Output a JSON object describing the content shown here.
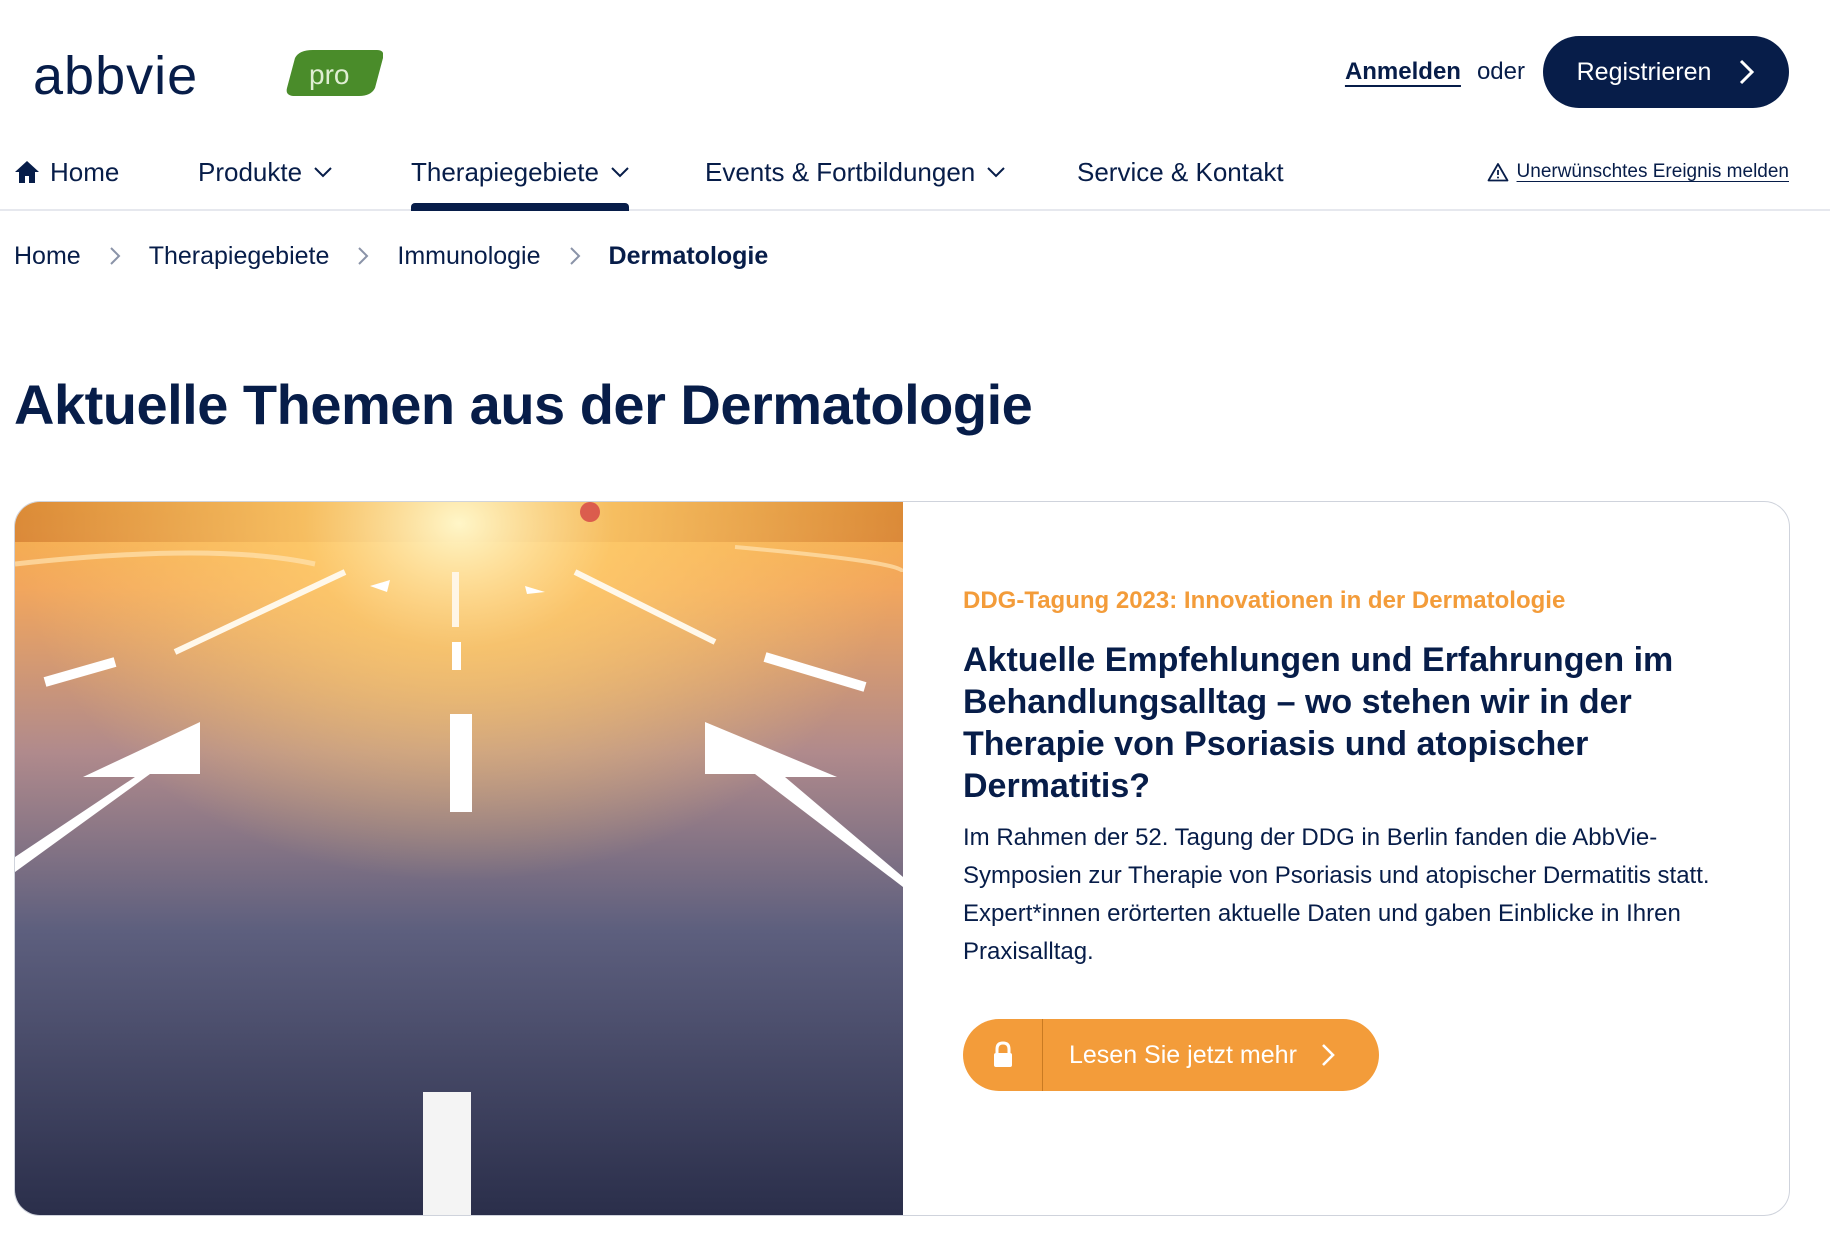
{
  "header": {
    "logo_word": "abbvie",
    "logo_badge": "pro",
    "login_label": "Anmelden",
    "or_label": "oder",
    "register_label": "Registrieren"
  },
  "nav": {
    "items": [
      {
        "label": "Home",
        "icon": "home-icon"
      },
      {
        "label": "Produkte",
        "icon": "chevron-down-icon"
      },
      {
        "label": "Therapiegebiete",
        "icon": "chevron-down-icon",
        "active": true
      },
      {
        "label": "Events & Fortbildungen",
        "icon": "chevron-down-icon"
      },
      {
        "label": "Service & Kontakt"
      }
    ],
    "report_label": "Unerwünschtes Ereignis melden"
  },
  "breadcrumb": [
    "Home",
    "Therapiegebiete",
    "Immunologie",
    "Dermatologie"
  ],
  "page_title": "Aktuelle Themen aus der Dermatologie",
  "card": {
    "eyebrow": "DDG-Tagung 2023: Innovationen in der Dermatologie",
    "title": "Aktuelle Empfehlungen und Erfahrungen im Behandlungsalltag – wo stehen wir in der Therapie von Psoriasis und atopischer Dermatitis?",
    "text": "Im Rahmen der 52. Tagung der DDG in Berlin fanden die AbbVie-Symposien zur Therapie von Psoriasis und atopischer Dermatitis statt. Expert*innen erörterten aktuelle Daten und gaben Einblicke in Ihren Praxisalltag.",
    "cta_label": "Lesen Sie jetzt mehr"
  },
  "colors": {
    "navy": "#071d49",
    "orange": "#f39c3a",
    "logo_green": "#4a8c2a"
  }
}
